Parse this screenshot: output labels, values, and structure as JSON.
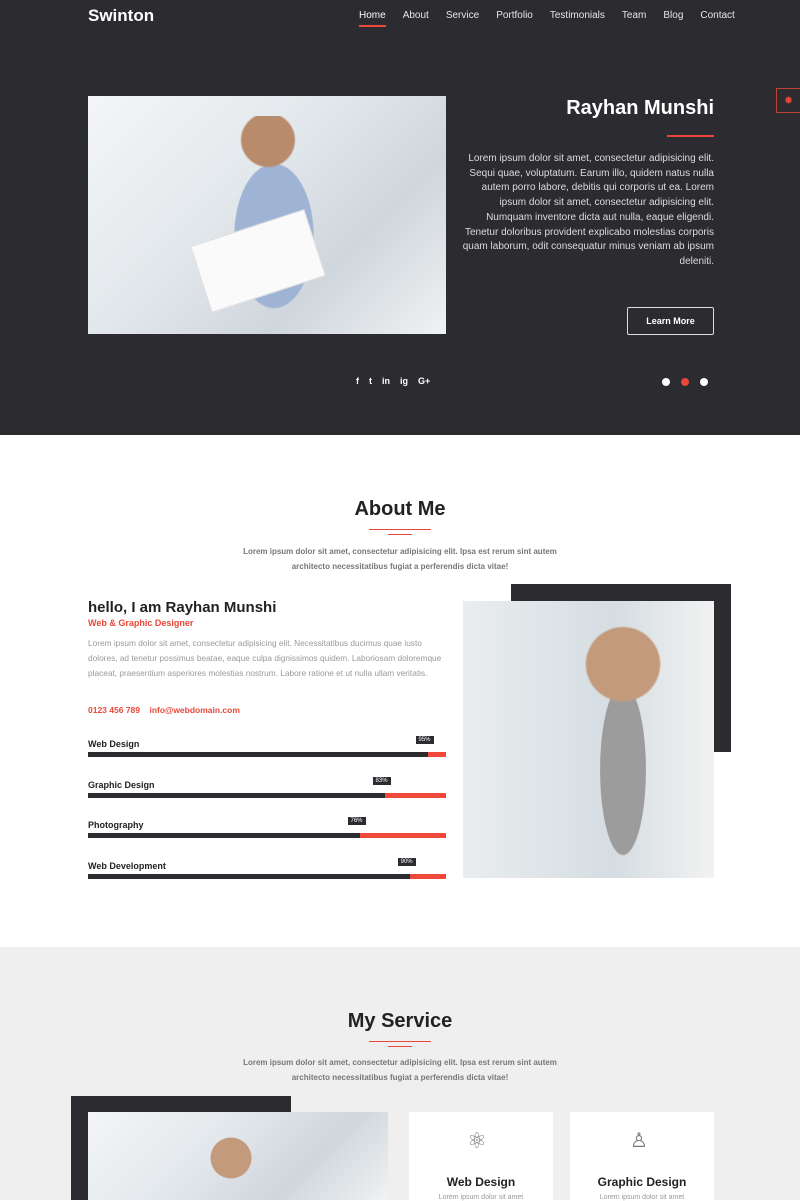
{
  "header": {
    "logo": "Swinton",
    "nav": [
      "Home",
      "About",
      "Service",
      "Portfolio",
      "Testimonials",
      "Team",
      "Blog",
      "Contact"
    ],
    "active": "Home"
  },
  "hero": {
    "name": "Rayhan Munshi",
    "paragraph": "Lorem ipsum dolor sit amet, consectetur adipisicing elit. Sequi quae, voluptatum. Earum illo, quidem natus nulla autem porro labore, debitis qui corporis ut ea. Lorem ipsum dolor sit amet, consectetur adipisicing elit. Numquam inventore dicta aut nulla, eaque eligendi. Tenetur doloribus provident explicabo molestias corporis quam laborum, odit consequatur minus veniam ab ipsum deleniti.",
    "button": "Learn More",
    "social": [
      "f",
      "t",
      "in",
      "ig",
      "G+"
    ],
    "slider_active": 2,
    "accent": "#e8473a",
    "background": "#2b2b30"
  },
  "about": {
    "title": "About Me",
    "subtitle_line1": "Lorem ipsum dolor sit amet, consectetur adipisicing elit. Ipsa est rerum sint autem",
    "subtitle_line2": "architecto necessitatibus fugiat a perferendis dicta vitae!",
    "hello": "hello, I am Rayhan Munshi",
    "role": "Web & Graphic Designer",
    "paragraph": "Lorem ipsum dolor sit amet, consectetur adipisicing elit. Necessitatibus ducimus quae iusto dolores, ad tenetur possimus beatae, eaque culpa dignissimos quidem. Laboriosam doloremque placeat, praesentium asperiores molestias nostrum. Labore ratione et ut nulla ullam veritatis.",
    "phone": "0123 456 789",
    "email": "info@webdomain.com",
    "skills": [
      {
        "name": "Web Design",
        "percent": 95,
        "label": "95%"
      },
      {
        "name": "Graphic Design",
        "percent": 83,
        "label": "83%"
      },
      {
        "name": "Photography",
        "percent": 76,
        "label": "76%"
      },
      {
        "name": "Web Development",
        "percent": 90,
        "label": "90%"
      }
    ]
  },
  "service": {
    "title": "My Service",
    "subtitle_line1": "Lorem ipsum dolor sit amet, consectetur adipisicing elit. Ipsa est rerum sint autem",
    "subtitle_line2": "architecto necessitatibus fugiat a perferendis dicta vitae!",
    "cards": [
      {
        "title": "Web Design",
        "text": "Lorem ipsum dolor sit amet",
        "icon": "atom-icon"
      },
      {
        "title": "Graphic Design",
        "text": "Lorem ipsum dolor sit amet",
        "icon": "designer-icon"
      }
    ]
  }
}
